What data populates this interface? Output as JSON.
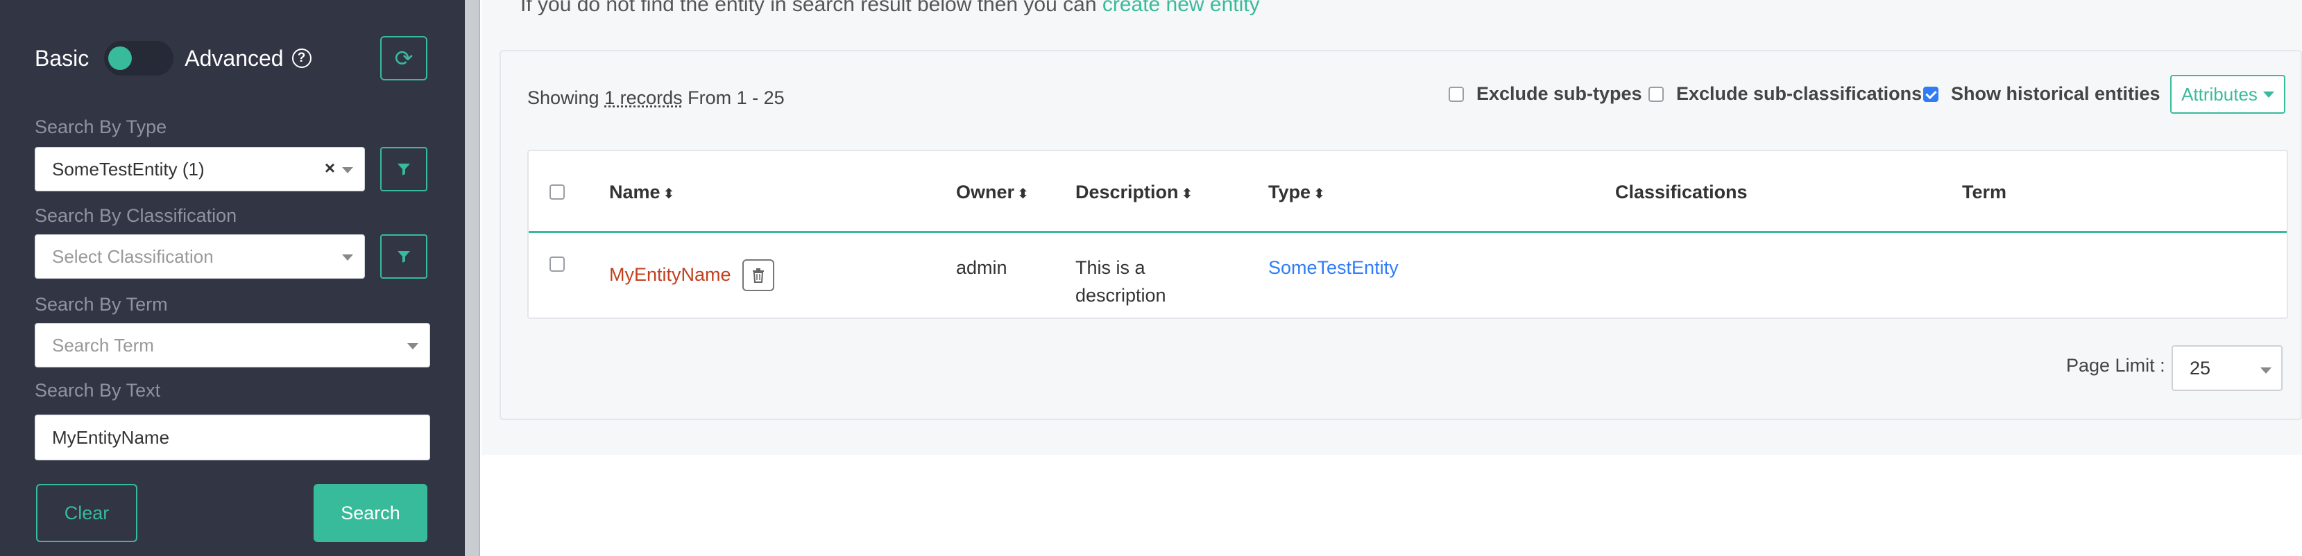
{
  "sidebar": {
    "mode_basic": "Basic",
    "mode_advanced": "Advanced",
    "type_label": "Search By Type",
    "type_value": "SomeTestEntity (1)",
    "classification_label": "Search By Classification",
    "classification_placeholder": "Select Classification",
    "term_label": "Search By Term",
    "term_placeholder": "Search Term",
    "text_label": "Search By Text",
    "text_value": "MyEntityName",
    "clear_label": "Clear",
    "search_label": "Search",
    "accent_color": "#38bb9b"
  },
  "main": {
    "info_prefix": "If you do not find the entity in search result below then you can ",
    "info_link": "create new entity",
    "showing_prefix": "Showing ",
    "showing_records": "1 records",
    "showing_suffix": " From 1 - 25",
    "options": [
      {
        "label": "Exclude sub-types",
        "checked": false
      },
      {
        "label": "Exclude sub-classifications",
        "checked": false
      },
      {
        "label": "Show historical entities",
        "checked": true
      }
    ],
    "attributes_label": "Attributes",
    "columns": [
      "Name",
      "Owner",
      "Description",
      "Type",
      "Classifications",
      "Term"
    ],
    "rows": [
      {
        "name": "MyEntityName",
        "owner": "admin",
        "description_line1": "This is a",
        "description_line2": "description",
        "type": "SomeTestEntity"
      }
    ],
    "page_limit_label": "Page Limit :",
    "page_limit_value": "25"
  }
}
